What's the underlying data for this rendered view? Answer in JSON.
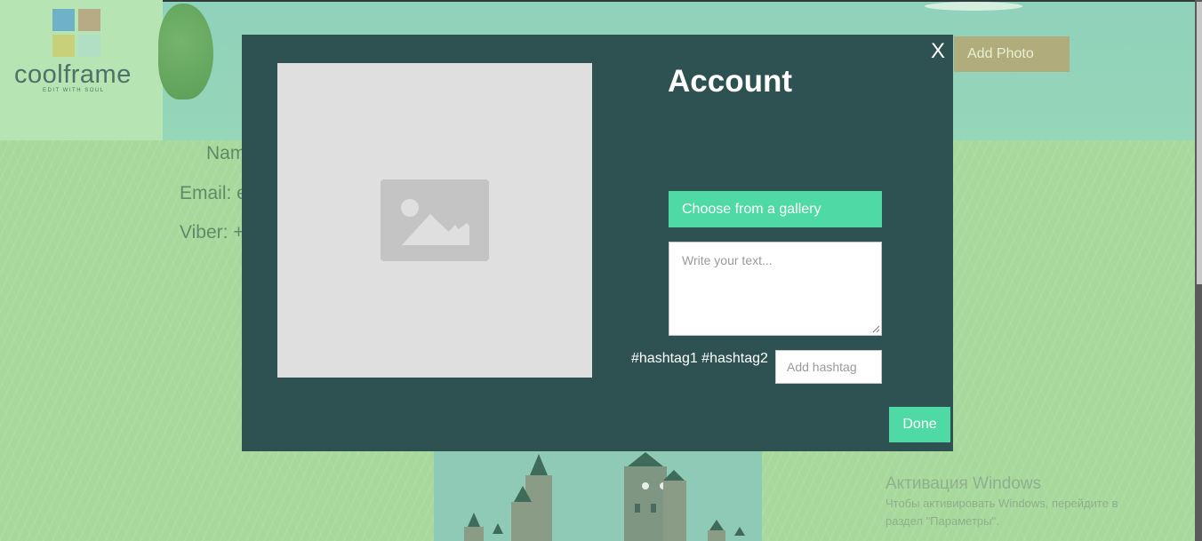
{
  "logo": {
    "name": "coolframe",
    "tagline": "EDIT WITH SOUL",
    "colors": [
      "#6fb2c7",
      "#b7ab86",
      "#c8d17a",
      "#b1dfc5"
    ]
  },
  "profile": {
    "name_label": "Nam",
    "email_label": "Email: e",
    "viber_label": "Viber: +"
  },
  "header": {
    "add_photo_label": "Add Photo"
  },
  "modal": {
    "close_label": "X",
    "title": "Account",
    "gallery_button": "Choose from a gallery",
    "text_placeholder": "Write your text...",
    "hashtags": "#hashtag1 #hashtag2",
    "hashtag_placeholder": "Add hashtag",
    "done_label": "Done",
    "image_icon": "image-placeholder-icon"
  },
  "windows_watermark": {
    "title": "Активация Windows",
    "line1": "Чтобы активировать Windows, перейдите в",
    "line2": "раздел \"Параметры\"."
  },
  "colors": {
    "modal_bg": "#2e5151",
    "accent": "#4fd9a4",
    "add_photo_bg": "#b0ac7c"
  }
}
